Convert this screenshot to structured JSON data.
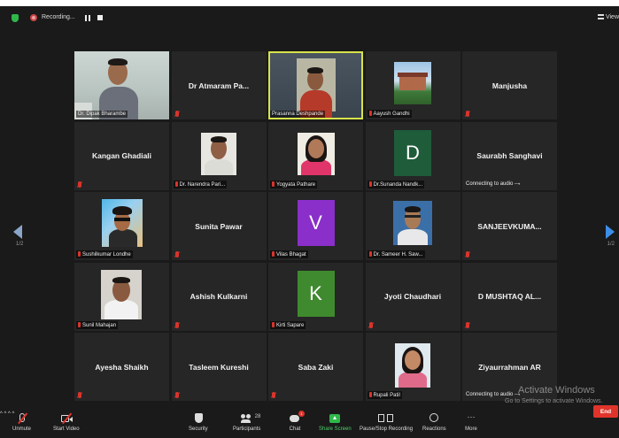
{
  "topbar": {
    "recording_label": "Recording...",
    "view_label": "View"
  },
  "grid": {
    "tiles": [
      {
        "name": "Dr. Dipak Bharambe"
      },
      {
        "name": "Dr Atmaram Pa..."
      },
      {
        "name": "Prasanna Deshpande"
      },
      {
        "name": "Aayush Gandhi"
      },
      {
        "name": "Manjusha"
      },
      {
        "name": "Kangan Ghadiali"
      },
      {
        "name": "Dr. Narendra Pari..."
      },
      {
        "name": "Yogyata Pathare"
      },
      {
        "name": "Dr.Sunanda Nandk...",
        "initial": "D"
      },
      {
        "name": "Saurabh Sanghavi",
        "status": "Connecting to audio"
      },
      {
        "name": "Sushilkumar Londhe"
      },
      {
        "name": "Sunita Pawar"
      },
      {
        "name": "Vilas Bhagat",
        "initial": "V"
      },
      {
        "name": "Dr. Sameer H. Saw..."
      },
      {
        "name": "SANJEEVKUMA..."
      },
      {
        "name": "Sunil Mahajan"
      },
      {
        "name": "Ashish Kulkarni"
      },
      {
        "name": "Kirti Sapare",
        "initial": "K"
      },
      {
        "name": "Jyoti Chaudhari"
      },
      {
        "name": "D MUSHTAQ AL..."
      },
      {
        "name": "Ayesha Shaikh"
      },
      {
        "name": "Tasleem Kureshi"
      },
      {
        "name": "Saba Zaki"
      },
      {
        "name": "Rupali Patil"
      },
      {
        "name": "Ziyaurrahman AR",
        "status": "Connecting to audio"
      }
    ],
    "colors": {
      "active_border": "#d8e34a",
      "tile_bg": "#262626",
      "letter_D": "#1f5c3a",
      "letter_V": "#8a2fc9",
      "letter_K": "#3f8a2e"
    }
  },
  "pagination": {
    "left": "1/2",
    "right": "1/2"
  },
  "watermark": {
    "title": "Activate Windows",
    "subtitle": "Go to Settings to activate Windows."
  },
  "toolbar": {
    "unmute": "Unmute",
    "start_video": "Start Video",
    "security": "Security",
    "participants": "Participants",
    "participants_count": "28",
    "chat": "Chat",
    "chat_badge": "1",
    "share_screen": "Share Screen",
    "pause_recording": "Pause/Stop Recording",
    "reactions": "Reactions",
    "more": "More",
    "end": "End"
  }
}
